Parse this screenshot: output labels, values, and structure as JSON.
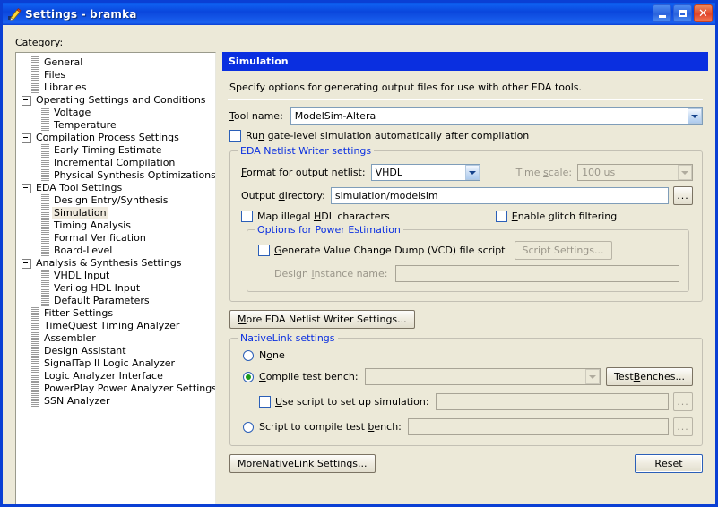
{
  "window": {
    "title": "Settings - bramka",
    "icon": "pencil-icon",
    "minimize": "minimize-icon",
    "maximize": "maximize-icon",
    "close": "close-icon",
    "titlebar_color": "#0a46dc",
    "background_color": "#ece9d8"
  },
  "category": {
    "label": "Category:",
    "selected": "Simulation",
    "items": [
      {
        "label": "General",
        "depth": 1,
        "expander": false
      },
      {
        "label": "Files",
        "depth": 1,
        "expander": false
      },
      {
        "label": "Libraries",
        "depth": 1,
        "expander": false
      },
      {
        "label": "Operating Settings and Conditions",
        "depth": 0,
        "expander": true
      },
      {
        "label": "Voltage",
        "depth": 2,
        "expander": false
      },
      {
        "label": "Temperature",
        "depth": 2,
        "expander": false
      },
      {
        "label": "Compilation Process Settings",
        "depth": 0,
        "expander": true
      },
      {
        "label": "Early Timing Estimate",
        "depth": 2,
        "expander": false
      },
      {
        "label": "Incremental Compilation",
        "depth": 2,
        "expander": false
      },
      {
        "label": "Physical Synthesis Optimizations",
        "depth": 2,
        "expander": false
      },
      {
        "label": "EDA Tool Settings",
        "depth": 0,
        "expander": true
      },
      {
        "label": "Design Entry/Synthesis",
        "depth": 2,
        "expander": false
      },
      {
        "label": "Simulation",
        "depth": 2,
        "expander": false
      },
      {
        "label": "Timing Analysis",
        "depth": 2,
        "expander": false
      },
      {
        "label": "Formal Verification",
        "depth": 2,
        "expander": false
      },
      {
        "label": "Board-Level",
        "depth": 2,
        "expander": false
      },
      {
        "label": "Analysis & Synthesis Settings",
        "depth": 0,
        "expander": true
      },
      {
        "label": "VHDL Input",
        "depth": 2,
        "expander": false
      },
      {
        "label": "Verilog HDL Input",
        "depth": 2,
        "expander": false
      },
      {
        "label": "Default Parameters",
        "depth": 2,
        "expander": false
      },
      {
        "label": "Fitter Settings",
        "depth": 1,
        "expander": false
      },
      {
        "label": "TimeQuest Timing Analyzer",
        "depth": 1,
        "expander": false
      },
      {
        "label": "Assembler",
        "depth": 1,
        "expander": false
      },
      {
        "label": "Design Assistant",
        "depth": 1,
        "expander": false
      },
      {
        "label": "SignalTap II Logic Analyzer",
        "depth": 1,
        "expander": false
      },
      {
        "label": "Logic Analyzer Interface",
        "depth": 1,
        "expander": false
      },
      {
        "label": "PowerPlay Power Analyzer Settings",
        "depth": 1,
        "expander": false
      },
      {
        "label": "SSN Analyzer",
        "depth": 1,
        "expander": false
      }
    ]
  },
  "panel": {
    "header": "Simulation",
    "description": "Specify options for generating output files for use with other EDA tools.",
    "tool_name": {
      "label": "Tool name:",
      "label_mnemonic": "T",
      "value": "ModelSim-Altera",
      "arrow": "chevron-down-icon"
    },
    "run_gate_level": {
      "label": "Run gate-level simulation automatically after compilation",
      "checked": false
    },
    "eda_netlist": {
      "title": "EDA Netlist Writer settings",
      "format": {
        "label": "Format for output netlist:",
        "value": "VHDL"
      },
      "time_scale": {
        "label": "Time scale:",
        "value": "100 us",
        "enabled": false
      },
      "output_dir": {
        "label": "Output directory:",
        "value": "simulation/modelsim",
        "browse": "..."
      },
      "map_illegal": {
        "label": "Map illegal HDL characters",
        "checked": false
      },
      "glitch_filter": {
        "label": "Enable glitch filtering",
        "checked": false
      },
      "power": {
        "title": "Options for Power Estimation",
        "vcd": {
          "label": "Generate Value Change Dump (VCD) file script",
          "checked": false
        },
        "script_settings_button": {
          "label": "Script Settings...",
          "enabled": false
        },
        "design_instance": {
          "label": "Design instance name:",
          "value": "",
          "enabled": false
        }
      }
    },
    "more_eda_button": "More EDA Netlist Writer Settings...",
    "nativelink": {
      "title": "NativeLink settings",
      "none": {
        "label": "None",
        "selected": false
      },
      "compile_tb": {
        "label": "Compile test bench:",
        "selected": true,
        "value": "",
        "button": "Test Benches...",
        "combo_enabled": false
      },
      "use_script": {
        "label": "Use script to set up simulation:",
        "checked": false,
        "value": "",
        "browse": "...",
        "enabled": false
      },
      "script_compile_tb": {
        "label": "Script to compile test bench:",
        "selected": false,
        "value": "",
        "browse": "...",
        "enabled": false
      }
    },
    "more_nativelink_button": "More NativeLink Settings...",
    "reset_button": "Reset"
  }
}
